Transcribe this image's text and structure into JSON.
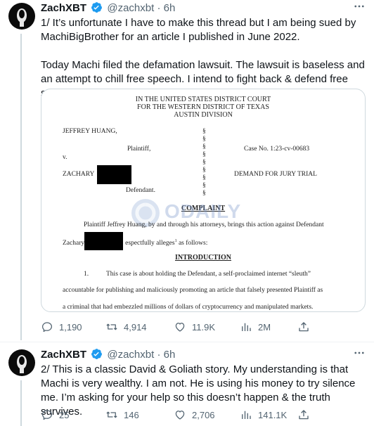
{
  "colors": {
    "text": "#0f1419",
    "secondary": "#536471",
    "verified": "#1d9bf0",
    "border": "#cfd9de"
  },
  "tweets": [
    {
      "author_name": "ZachXBT",
      "handle": "@zachxbt",
      "separator": "·",
      "time": "6h",
      "more_icon": "more-horizontal-icon",
      "paragraphs": [
        "1/ It’s unfortunate I have to make this thread but I am being sued by MachiBigBrother for an article I published in June 2022.",
        "Today Machi filed the defamation lawsuit. The lawsuit is baseless and an attempt to chill free speech. I intend to fight back & defend free speech."
      ],
      "actions": {
        "replies": "1,190",
        "retweets": "4,914",
        "likes": "11.9K",
        "views": "2M"
      }
    },
    {
      "author_name": "ZachXBT",
      "handle": "@zachxbt",
      "separator": "·",
      "time": "6h",
      "more_icon": "more-horizontal-icon",
      "text": "2/ This is a classic David & Goliath story.  My understanding is that Machi is very wealthy. I am not. He is using his money to try silence me. I’m asking for your help so this doesn’t happen & the truth survives.",
      "actions": {
        "replies": "25",
        "retweets": "146",
        "likes": "2,706",
        "views": "141.1K"
      }
    }
  ],
  "document": {
    "court_line1": "IN THE UNITED STATES DISTRICT COURT",
    "court_line2": "FOR THE WESTERN DISTRICT OF TEXAS",
    "court_line3": "AUSTIN DIVISION",
    "plaintiff_name": "JEFFREY HUANG,",
    "plaintiff_role": "Plaintiff,",
    "versus": "v.",
    "defendant_name": "ZACHARY",
    "defendant_role": "Defendant.",
    "case_no": "Case No. 1:23-cv-00683",
    "jury_demand": "DEMAND FOR JURY TRIAL",
    "section_symbol": "§",
    "complaint_heading": "COMPLAINT",
    "complaint_line1": "Plaintiff Jeffrey Huang, by and through his attorneys, brings this action against Defendant",
    "complaint_line2_a": "Zachary",
    "complaint_line2_b": "espectfully alleges",
    "complaint_line2_sup": "1",
    "complaint_line2_c": " as follows:",
    "intro_heading": "INTRODUCTION",
    "para_number": "1.",
    "para1_line1": "This case is about holding the Defendant, a self-proclaimed internet “sleuth”",
    "para1_line2": "accountable for publishing and maliciously promoting an article that falsely presented Plaintiff as",
    "para1_line3": "a criminal that had embezzled millions of dollars of cryptocurrency and manipulated markets.",
    "watermark": "ODAILY"
  }
}
